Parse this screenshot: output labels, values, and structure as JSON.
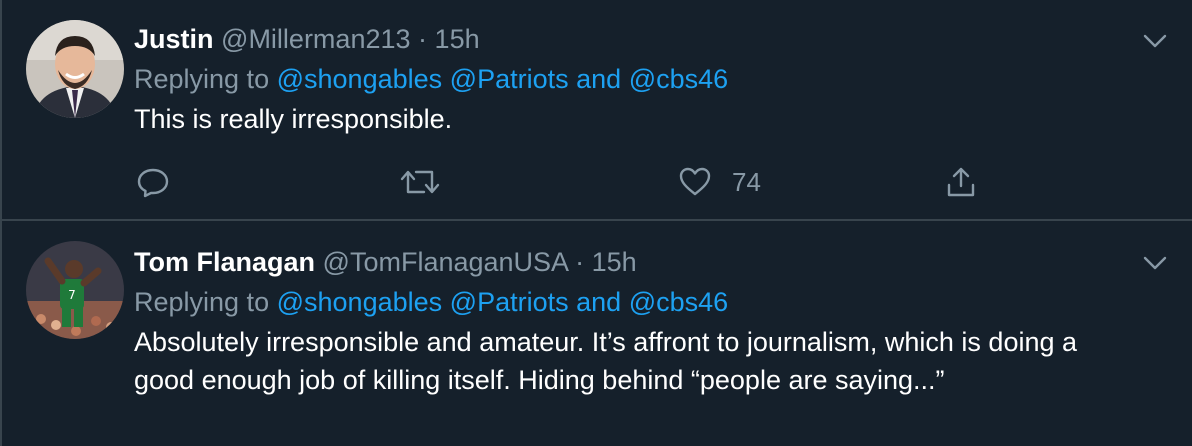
{
  "tweets": [
    {
      "name": "Justin",
      "handle": "@Millerman213",
      "separator": "·",
      "time": "15h",
      "replying_prefix": "Replying to",
      "mention1": "@shongables",
      "mention2": "@Patriots",
      "joiner": "and",
      "mention3": "@cbs46",
      "text": "This is really irresponsible.",
      "likes": "74"
    },
    {
      "name": "Tom Flanagan",
      "handle": "@TomFlanaganUSA",
      "separator": "·",
      "time": "15h",
      "replying_prefix": "Replying to",
      "mention1": "@shongables",
      "mention2": "@Patriots",
      "joiner": "and",
      "mention3": "@cbs46",
      "text": "Absolutely irresponsible and amateur. It’s affront to journalism, which is doing a good enough job of killing itself. Hiding behind “people are saying...”"
    }
  ],
  "icons": {
    "more": "chevron-down-icon",
    "reply": "reply-icon",
    "retweet": "retweet-icon",
    "like": "heart-icon",
    "share": "share-icon"
  },
  "colors": {
    "background": "#15202b",
    "border": "#38444d",
    "secondary_text": "#8899a6",
    "link": "#1da1f2"
  }
}
